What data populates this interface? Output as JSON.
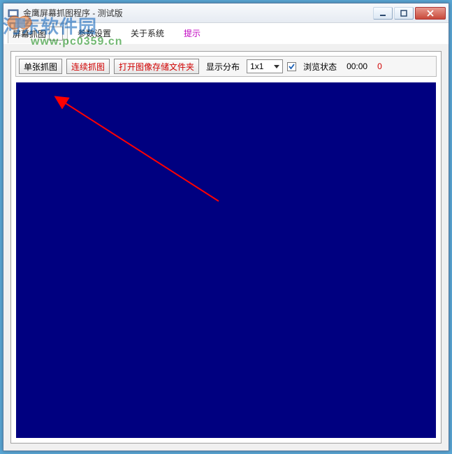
{
  "window": {
    "title": "金鹰屏幕抓图程序 - 测试版"
  },
  "menu": {
    "capture": "屏幕抓图",
    "settings": "参数设置",
    "about": "关于系统",
    "tip": "提示"
  },
  "toolbar": {
    "single_capture": "单张抓图",
    "continuous_capture": "连续抓图",
    "open_folder": "打开图像存储文件夹",
    "layout_label": "显示分布",
    "layout_value": "1x1",
    "browse_checked": true,
    "browse_label": "浏览状态",
    "time": "00:00",
    "count": "0"
  },
  "watermark": {
    "site_name": "河东软件园",
    "url": "www.pc0359.cn"
  }
}
